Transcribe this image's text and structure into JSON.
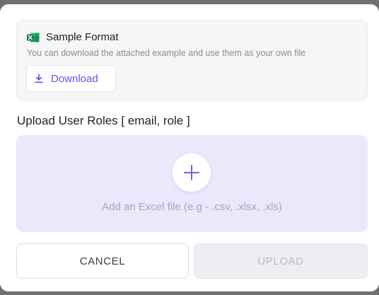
{
  "sample": {
    "title": "Sample Format",
    "description": "You can download the attached example and use them as your own file",
    "download_label": "Download",
    "icon": "excel-icon"
  },
  "upload": {
    "label": "Upload User Roles [ email, role ]",
    "hint": "Add an Excel file (e.g - .csv, .xlsx, .xls)",
    "icon": "plus-icon"
  },
  "actions": {
    "cancel_label": "CANCEL",
    "upload_label": "UPLOAD"
  },
  "colors": {
    "accent": "#6d4fe6",
    "dropzone_bg": "#ebe8fc",
    "excel_green": "#21a366"
  }
}
